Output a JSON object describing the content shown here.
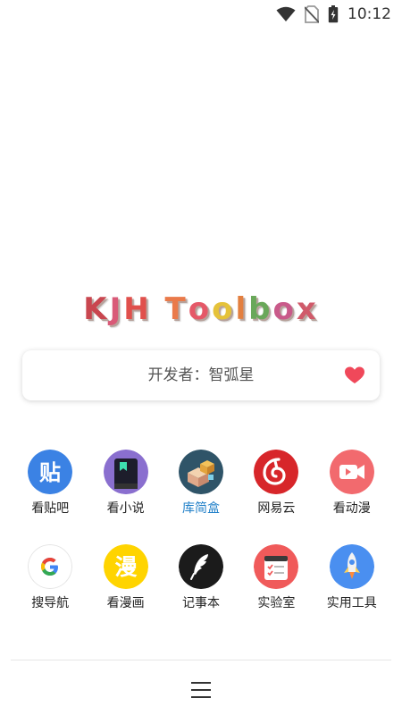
{
  "status_bar": {
    "time": "10:12",
    "icons": [
      "wifi-icon",
      "no-sim-icon",
      "battery-icon"
    ]
  },
  "title": {
    "text": "KJH Toolbox",
    "letters": [
      "K",
      "J",
      "H",
      "T",
      "o",
      "o",
      "l",
      "b",
      "o",
      "x"
    ],
    "letter_colors": [
      "#c9464f",
      "#d95a78",
      "#e0504c",
      "#ea7a4a",
      "#e55868",
      "#e5c23a",
      "#e37f3f",
      "#6aa85a",
      "#c95a8a",
      "#d05a6a"
    ]
  },
  "developer": {
    "text": "开发者：智弧星",
    "heart_color": "#f0485a"
  },
  "apps": [
    {
      "label": "看贴吧",
      "icon": "tieba-icon",
      "glyph": "贴",
      "color": "#3b82e4"
    },
    {
      "label": "看小说",
      "icon": "novel-icon",
      "color": "#8a6fcf"
    },
    {
      "label": "库简盒",
      "icon": "box-icon",
      "color": "#2f5468",
      "accent": true
    },
    {
      "label": "网易云",
      "icon": "netease-music-icon",
      "color": "#d7262a"
    },
    {
      "label": "看动漫",
      "icon": "video-icon",
      "color": "#f26a6e"
    },
    {
      "label": "搜导航",
      "icon": "google-icon",
      "glyph": "G",
      "color": "#ffffff"
    },
    {
      "label": "看漫画",
      "icon": "manga-icon",
      "glyph": "漫",
      "color": "#ffd400"
    },
    {
      "label": "记事本",
      "icon": "feather-icon",
      "color": "#1b1b1b"
    },
    {
      "label": "实验室",
      "icon": "checklist-icon",
      "color": "#f05a5a"
    },
    {
      "label": "实用工具",
      "icon": "rocket-icon",
      "color": "#4a8ff0"
    }
  ],
  "bottom_menu_icon": "hamburger-menu-icon"
}
